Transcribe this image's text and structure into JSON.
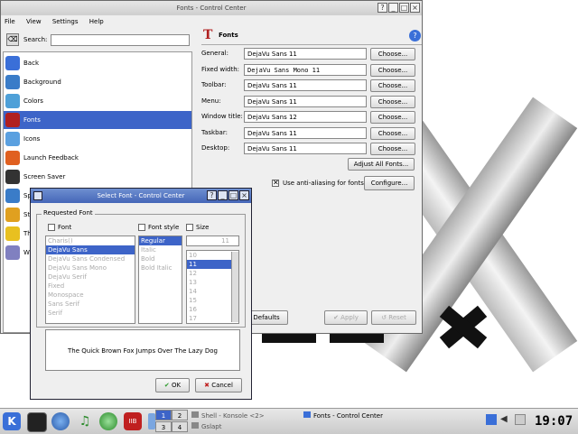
{
  "desktop": {
    "brand": "X"
  },
  "control_center": {
    "title": "Fonts - Control Center",
    "menu": [
      "File",
      "View",
      "Settings",
      "Help"
    ],
    "search_label": "Search:",
    "search_value": "",
    "sidebar": [
      {
        "label": "Back",
        "icon": "back-arrow-icon",
        "color": "#3a6fd8"
      },
      {
        "label": "Background",
        "icon": "background-icon",
        "color": "#3a7cc8"
      },
      {
        "label": "Colors",
        "icon": "colors-icon",
        "color": "#4ea0d8"
      },
      {
        "label": "Fonts",
        "icon": "fonts-icon",
        "color": "#b02020",
        "selected": true
      },
      {
        "label": "Icons",
        "icon": "icons-icon",
        "color": "#5aa0e0"
      },
      {
        "label": "Launch Feedback",
        "icon": "launch-feedback-icon",
        "color": "#e06020"
      },
      {
        "label": "Screen Saver",
        "icon": "screen-saver-icon",
        "color": "#333333"
      },
      {
        "label": "Sp",
        "icon": "splash-icon",
        "color": "#3a7cc8"
      },
      {
        "label": "Sty",
        "icon": "style-icon",
        "color": "#e0a020"
      },
      {
        "label": "Th",
        "icon": "theme-icon",
        "color": "#e8c020"
      },
      {
        "label": "Wi",
        "icon": "window-icon",
        "color": "#8080c0"
      }
    ],
    "panel_title": "Fonts",
    "font_rows": [
      {
        "label": "General:",
        "value": "DejaVu Sans 11",
        "button": "Choose..."
      },
      {
        "label": "Fixed width:",
        "value": "DejaVu Sans Mono 11",
        "button": "Choose..."
      },
      {
        "label": "Toolbar:",
        "value": "DejaVu Sans 11",
        "button": "Choose..."
      },
      {
        "label": "Menu:",
        "value": "DejaVu Sans 11",
        "button": "Choose..."
      },
      {
        "label": "Window title:",
        "value": "DejaVu Sans 12",
        "button": "Choose..."
      },
      {
        "label": "Taskbar:",
        "value": "DejaVu Sans 11",
        "button": "Choose..."
      },
      {
        "label": "Desktop:",
        "value": "DejaVu Sans 11",
        "button": "Choose..."
      }
    ],
    "adjust_all": "Adjust All Fonts...",
    "antialias_label": "Use anti-aliasing for fonts",
    "antialias_checked": true,
    "configure": "Configure...",
    "defaults": "Defaults",
    "apply": "Apply",
    "reset": "Reset"
  },
  "dialog": {
    "title": "Select Font - Control Center",
    "group_label": "Requested Font",
    "font_label": "Font",
    "style_label": "Font style",
    "size_label": "Size",
    "font_top": "Charis()",
    "fonts": [
      "DejaVu Sans",
      "DejaVu Sans Condensed",
      "DejaVu Sans Mono",
      "DejaVu Serif",
      "Fixed",
      "Monospace",
      "Sans Serif",
      "Serif"
    ],
    "styles": [
      "Regular",
      "Italic",
      "Bold",
      "Bold Italic"
    ],
    "size_value": "11",
    "sizes": [
      "10",
      "11",
      "12",
      "13",
      "14",
      "15",
      "16",
      "17"
    ],
    "preview": "The Quick Brown Fox Jumps Over The Lazy Dog",
    "ok": "OK",
    "cancel": "Cancel"
  },
  "taskbar": {
    "pager": [
      "1",
      "2",
      "3",
      "4"
    ],
    "tasks": [
      {
        "label": "Shell - Konsole <2>"
      },
      {
        "label": "Gslapt"
      },
      {
        "label": "Fonts - Control Center"
      }
    ],
    "clock": "19:07"
  },
  "colors": {
    "selection": "#3d64c8",
    "titlebar_active": "#4566b8"
  }
}
